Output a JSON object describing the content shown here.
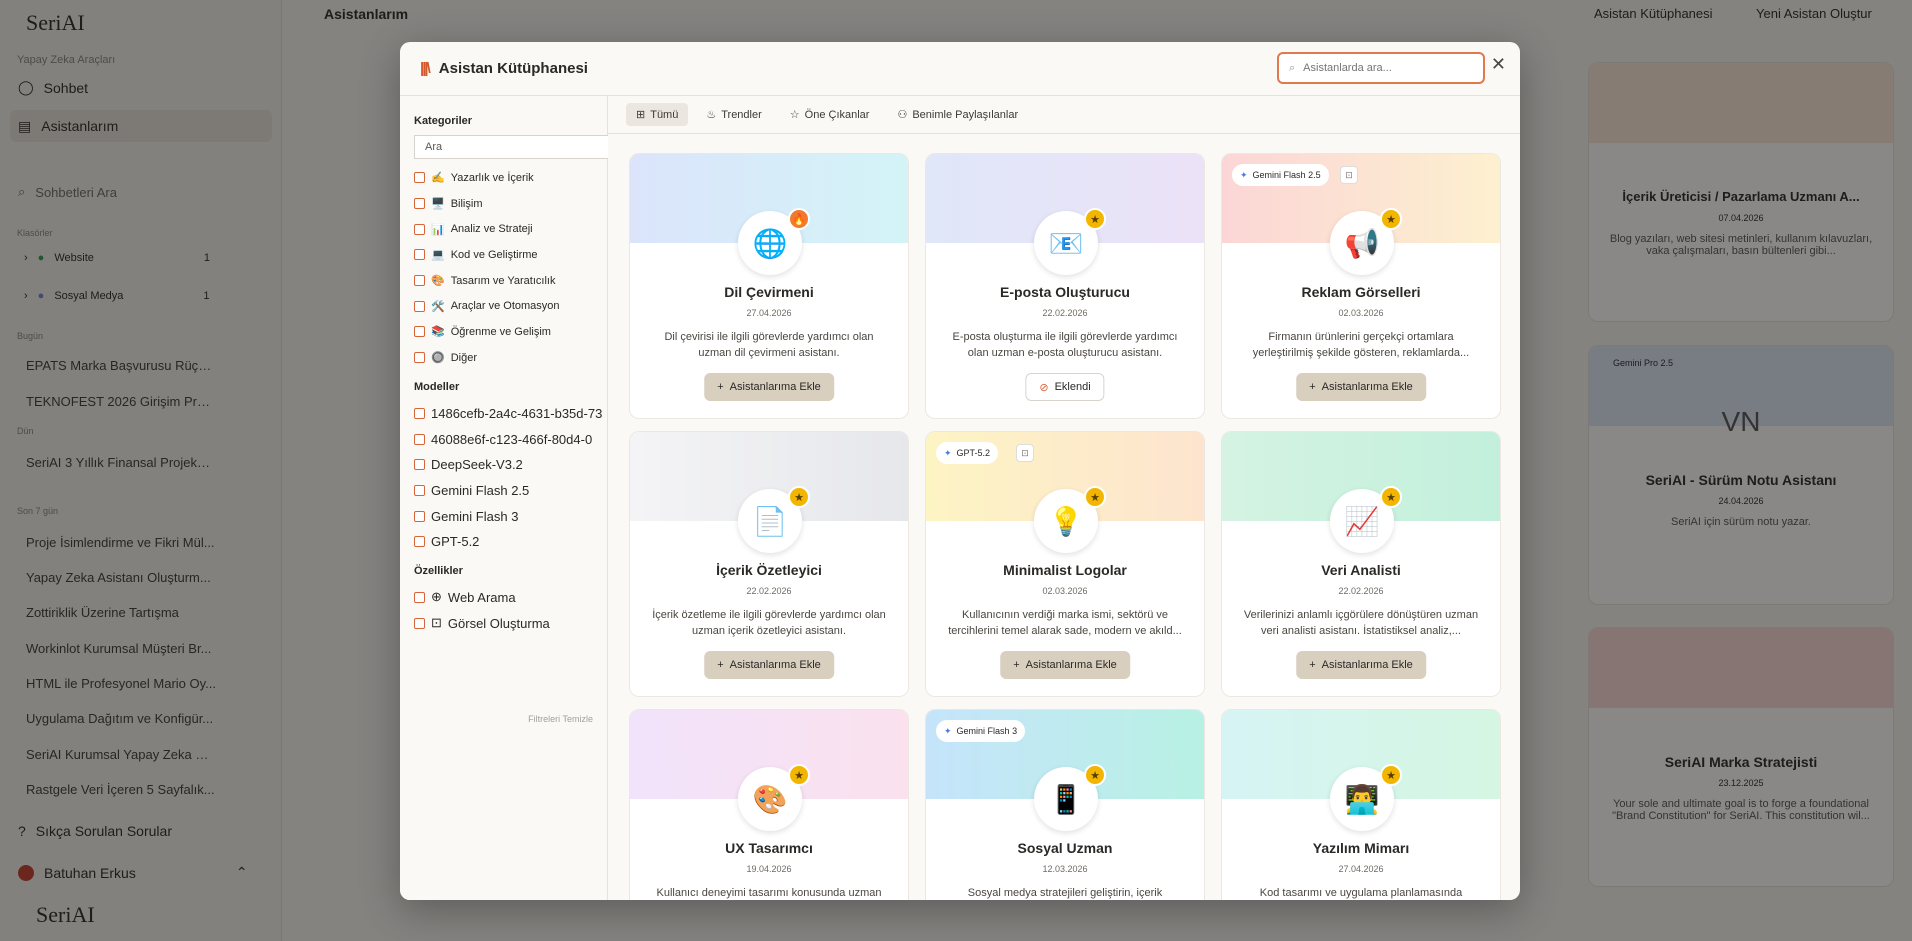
{
  "app": {
    "logo": "SeriAI"
  },
  "background": {
    "page_title": "Asistanlarım",
    "top_actions": [
      "Asistan Kütüphanesi",
      "Yeni Asistan Oluştur"
    ],
    "sidebar": {
      "section_tools": "Yapay Zeka Araçları",
      "items": [
        "Sohbet",
        "Asistanlarım"
      ],
      "search_placeholder": "Sohbetleri Ara",
      "folders_label": "Klasörler",
      "folders": [
        {
          "name": "Website",
          "count": "1"
        },
        {
          "name": "Sosyal Medya",
          "count": "1"
        }
      ],
      "today_label": "Bugün",
      "today_chats": [
        "EPATS Marka Başvurusu Rüçh...",
        "TEKNOFEST 2026 Girişim Prog..."
      ],
      "yesterday_label": "Dün",
      "yesterday_chats": [
        "SeriAI 3 Yıllık Finansal Projeksi..."
      ],
      "last7_label": "Son 7 gün",
      "last7_chats": [
        "Proje İsimlendirme ve Fikri Mül...",
        "Yapay Zeka Asistanı Oluşturm...",
        "Zottiriklik Üzerine Tartışma",
        "Workinlot Kurumsal Müşteri Br...",
        "HTML ile Profesyonel Mario Oy...",
        "Uygulama Dağıtım ve Konfigür...",
        "SeriAI Kurumsal Yapay Zeka Pl...",
        "Rastgele Veri İçeren 5 Sayfalık..."
      ],
      "faq": "Sıkça Sorulan Sorular",
      "user": "Batuhan Erkus"
    },
    "cards": [
      {
        "name": "İçerik Üreticisi / Pazarlama Uzmanı A...",
        "date": "07.04.2026",
        "desc": "Blog yazıları, web sitesi metinleri, kullanım kılavuzları, vaka çalışmaları, basın bültenleri gibi..."
      },
      {
        "name": "SeriAI - Sürüm Notu Asistanı",
        "date": "24.04.2026",
        "desc": "SeriAI için sürüm notu yazar.",
        "initials": "VN",
        "tag": "Gemini Pro 2.5"
      },
      {
        "name": "SeriAI Marka Stratejisti",
        "date": "23.12.2025",
        "desc": "Your sole and ultimate goal is to forge a foundational \"Brand Constitution\" for SeriAI. This constitution wil..."
      }
    ]
  },
  "modal": {
    "title": "Asistan Kütüphanesi",
    "search_placeholder": "Asistanlarda ara...",
    "close_glyph": "✕",
    "tabs": [
      {
        "label": "Tümü",
        "icon": "grid-icon",
        "glyph": "⊞"
      },
      {
        "label": "Trendler",
        "icon": "flame-icon",
        "glyph": "♨"
      },
      {
        "label": "Öne Çıkanlar",
        "icon": "star-icon",
        "glyph": "☆"
      },
      {
        "label": "Benimle Paylaşılanlar",
        "icon": "users-icon",
        "glyph": "⚇"
      }
    ],
    "filters": {
      "categories_title": "Kategoriler",
      "search_value": "Ara",
      "categories": [
        {
          "emoji": "✍️",
          "label": "Yazarlık ve İçerik"
        },
        {
          "emoji": "🖥️",
          "label": "Bilişim"
        },
        {
          "emoji": "📊",
          "label": "Analiz ve Strateji"
        },
        {
          "emoji": "💻",
          "label": "Kod ve Geliştirme"
        },
        {
          "emoji": "🎨",
          "label": "Tasarım ve Yaratıcılık"
        },
        {
          "emoji": "🛠️",
          "label": "Araçlar ve Otomasyon"
        },
        {
          "emoji": "📚",
          "label": "Öğrenme ve Gelişim"
        },
        {
          "emoji": "🔘",
          "label": "Diğer"
        }
      ],
      "models_title": "Modeller",
      "models": [
        "1486cefb-2a4c-4631-b35d-73",
        "46088e6f-c123-466f-80d4-0",
        "DeepSeek-V3.2",
        "Gemini Flash 2.5",
        "Gemini Flash 3",
        "GPT-5.2"
      ],
      "features_title": "Özellikler",
      "features": [
        {
          "glyph": "⊕",
          "label": "Web Arama"
        },
        {
          "glyph": "⊡",
          "label": "Görsel Oluşturma"
        }
      ],
      "clear_label": "Filtreleri Temizle"
    },
    "add_label": "Asistanlarıma Ekle",
    "added_label": "Eklendi",
    "cards": [
      {
        "name": "Dil Çevirmeni",
        "date": "27.04.2026",
        "desc": "Dil çevirisi ile ilgili görevlerde yardımcı olan uzman dil çevirmeni asistanı.",
        "emoji": "🌐",
        "badge": "fire",
        "badge_glyph": "🔥",
        "added": false,
        "grad": "linear-gradient(90deg,#dbe4fb,#d3f4f7)"
      },
      {
        "name": "E-posta Oluşturucu",
        "date": "22.02.2026",
        "desc": "E-posta oluşturma ile ilgili görevlerde yardımcı olan uzman e-posta oluşturucu asistanı.",
        "emoji": "📧",
        "badge": "star",
        "badge_glyph": "★",
        "added": true,
        "grad": "linear-gradient(90deg,#dfe7f8,#ece2f8)"
      },
      {
        "name": "Reklam Görselleri",
        "date": "02.03.2026",
        "desc": "Firmanın ürünlerini gerçekçi ortamlara yerleştirilmiş şekilde gösteren, reklamlarda...",
        "emoji": "📢",
        "badge": "star",
        "badge_glyph": "★",
        "added": false,
        "tag": "Gemini Flash 2.5",
        "image_tag": true,
        "grad": "linear-gradient(90deg,#fbd6d6,#fdf0cf)"
      },
      {
        "name": "İçerik Özetleyici",
        "date": "22.02.2026",
        "desc": "İçerik özetleme ile ilgili görevlerde yardımcı olan uzman içerik özetleyici asistanı.",
        "emoji": "📄",
        "badge": "star",
        "badge_glyph": "★",
        "added": false,
        "grad": "linear-gradient(90deg,#f4f4f6,#e6e7eb)"
      },
      {
        "name": "Minimalist Logolar",
        "date": "02.03.2026",
        "desc": "Kullanıcının verdiği marka ismi, sektörü ve tercihlerini temel alarak sade, modern ve akıld...",
        "emoji": "💡",
        "badge": "star",
        "badge_glyph": "★",
        "added": false,
        "tag": "GPT-5.2",
        "image_tag": true,
        "grad": "linear-gradient(90deg,#fdf4c4,#fde4cf)"
      },
      {
        "name": "Veri Analisti",
        "date": "22.02.2026",
        "desc": "Verilerinizi anlamlı içgörülere dönüştüren uzman veri analisti asistanı. İstatistiksel analiz,...",
        "emoji": "📈",
        "badge": "star",
        "badge_glyph": "★",
        "added": false,
        "grad": "linear-gradient(90deg,#d5f3e2,#c2f0dc)"
      },
      {
        "name": "UX Tasarımcı",
        "date": "19.04.2026",
        "desc": "Kullanıcı deneyimi tasarımı konusunda uzman",
        "emoji": "🎨",
        "badge": "star",
        "badge_glyph": "★",
        "added": false,
        "grad": "linear-gradient(90deg,#f1e3fb,#fbe1ee)"
      },
      {
        "name": "Sosyal Uzman",
        "date": "12.03.2026",
        "desc": "Sosyal medya stratejileri geliştirin, içerik",
        "emoji": "📱",
        "badge": "star",
        "badge_glyph": "★",
        "added": false,
        "tag": "Gemini Flash 3",
        "grad": "linear-gradient(90deg,#c5e4fb,#b8f1e4)"
      },
      {
        "name": "Yazılım Mimarı",
        "date": "27.04.2026",
        "desc": "Kod tasarımı ve uygulama planlamasında",
        "emoji": "👨‍💻",
        "badge": "star",
        "badge_glyph": "★",
        "added": false,
        "grad": "linear-gradient(90deg,#d6f4f4,#d5f6e2)"
      }
    ]
  }
}
